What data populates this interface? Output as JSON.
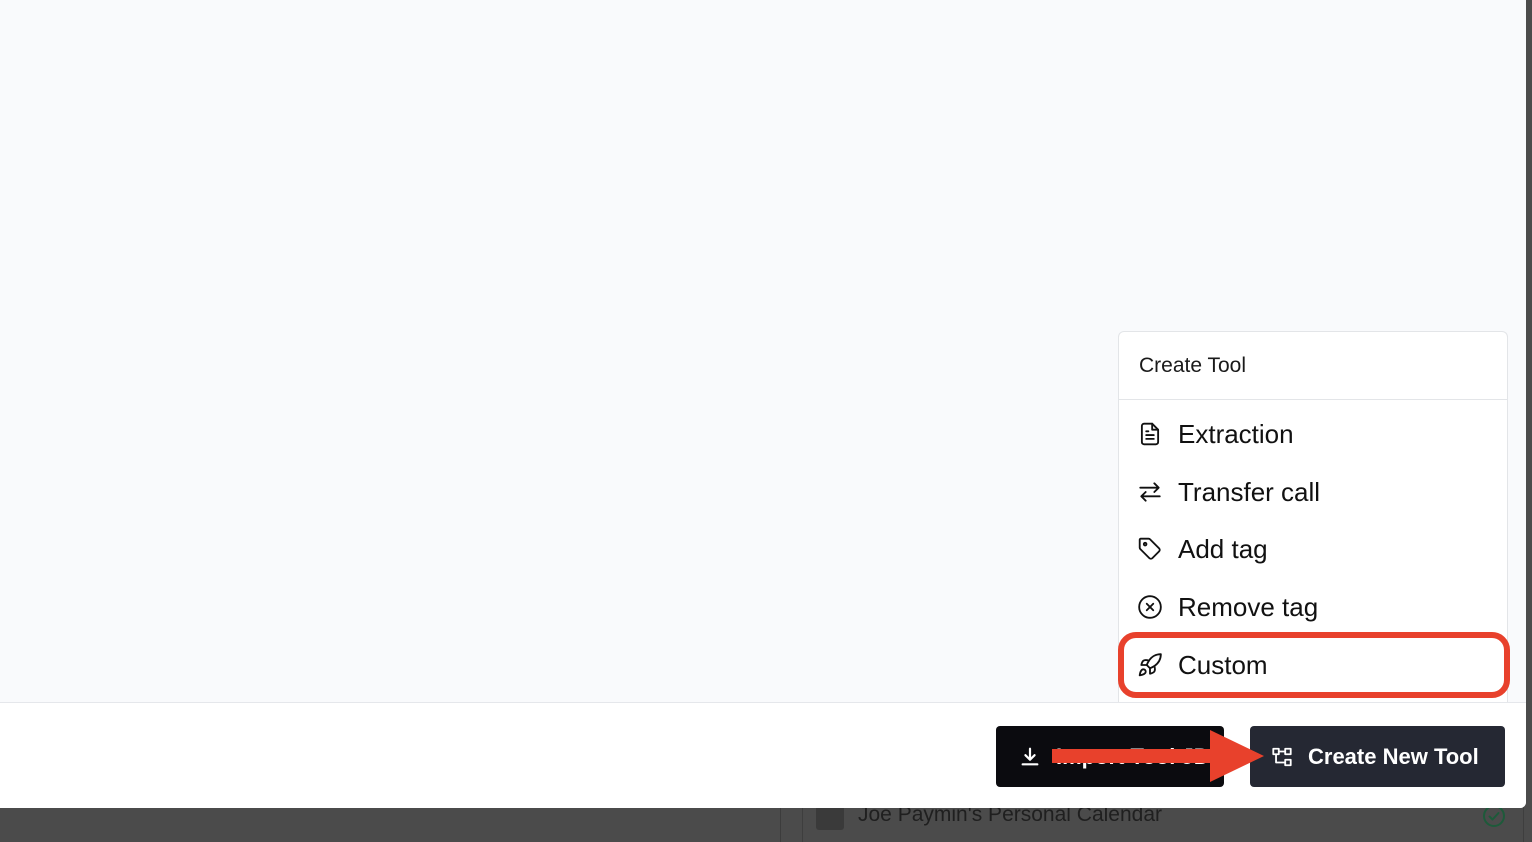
{
  "background": {
    "calendar_item_label": "Joe Paymin's Personal Calendar",
    "calendar_icon": "calendar-icon",
    "status_icon": "check-circle-icon"
  },
  "menu": {
    "title": "Create Tool",
    "items": [
      {
        "label": "Extraction",
        "icon": "document-icon"
      },
      {
        "label": "Transfer call",
        "icon": "transfer-arrows-icon"
      },
      {
        "label": "Add tag",
        "icon": "tag-icon"
      },
      {
        "label": "Remove tag",
        "icon": "x-circle-icon"
      },
      {
        "label": "Custom",
        "icon": "rocket-icon"
      }
    ],
    "highlighted_item": "Custom"
  },
  "footer": {
    "import_button": {
      "label": "Import Tool JD",
      "icon": "download-icon"
    },
    "create_button": {
      "label": "Create New Tool",
      "icon": "flow-diagram-icon"
    }
  },
  "colors": {
    "annotation_red": "#e8412c",
    "import_button_bg": "#0b0b0f",
    "create_button_bg": "#252833",
    "modal_bg": "#f9fafc"
  }
}
